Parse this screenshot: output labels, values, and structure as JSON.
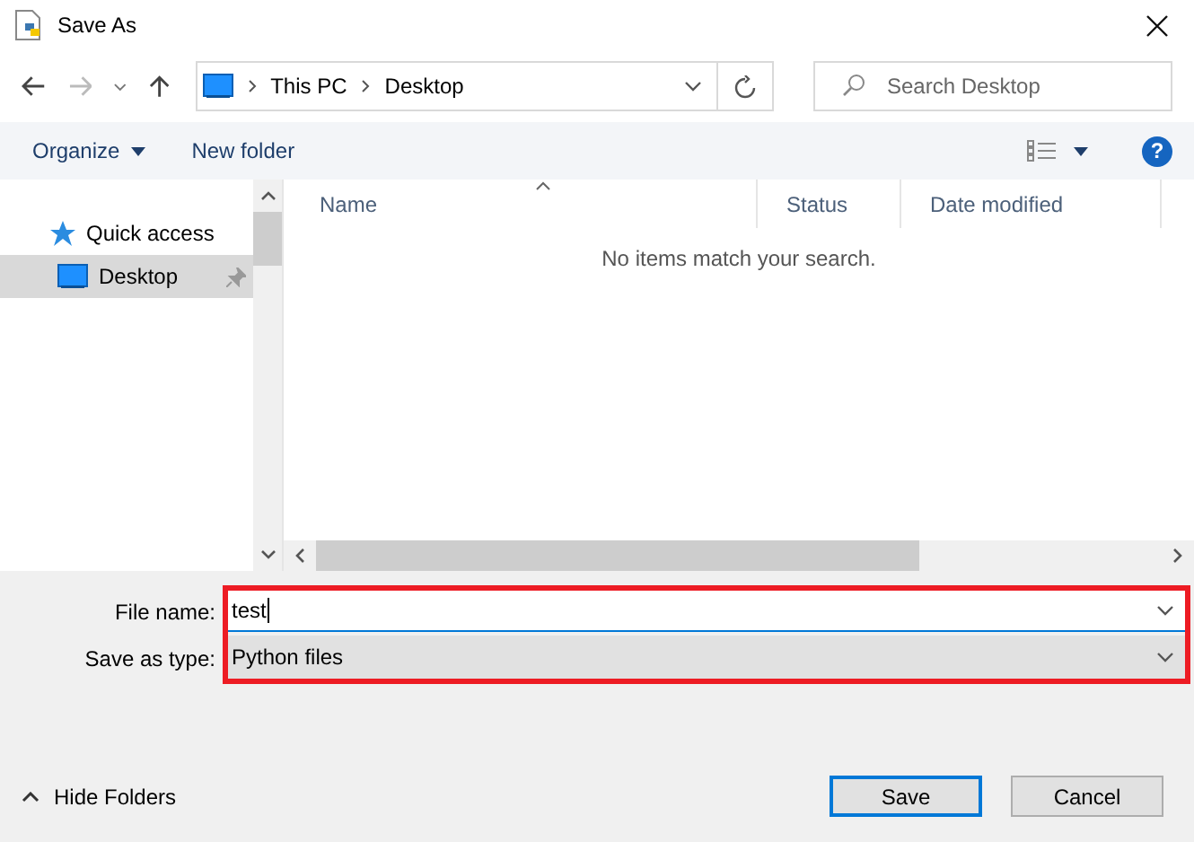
{
  "window": {
    "title": "Save As"
  },
  "navigation": {
    "back_enabled": true,
    "forward_enabled": false,
    "breadcrumb": [
      "This PC",
      "Desktop"
    ]
  },
  "search": {
    "placeholder": "Search Desktop"
  },
  "toolbar": {
    "buttons": [
      "Organize",
      "New folder"
    ],
    "help_symbol": "?"
  },
  "sidebar": {
    "items": [
      {
        "label": "Quick access",
        "kind": "star",
        "selected": false,
        "pinned": false
      },
      {
        "label": "Desktop",
        "kind": "desktop",
        "selected": true,
        "pinned": true
      }
    ]
  },
  "file_list": {
    "columns": [
      "Name",
      "Status",
      "Date modified"
    ],
    "empty_message": "No items match your search."
  },
  "form": {
    "fields": [
      {
        "label": "File name:",
        "value": "test",
        "kind": "edit"
      },
      {
        "label": "Save as type:",
        "value": "Python files",
        "kind": "combo"
      }
    ]
  },
  "hide_folders": "Hide Folders",
  "buttons": [
    {
      "label": "Save",
      "default": true
    },
    {
      "label": "Cancel",
      "default": false
    }
  ]
}
